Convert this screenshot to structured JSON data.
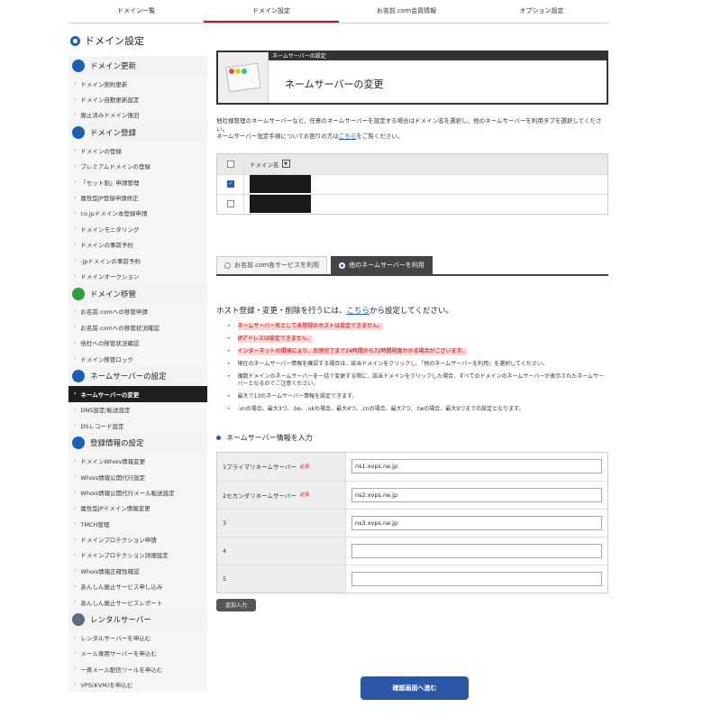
{
  "top_nav": [
    {
      "label": "ドメイン一覧",
      "active": false
    },
    {
      "label": "ドメイン設定",
      "active": true
    },
    {
      "label": "お名前.com会員情報",
      "active": false
    },
    {
      "label": "オプション設定",
      "active": false
    }
  ],
  "sidebar": {
    "title": "ドメイン設定",
    "groups": [
      {
        "label": "ドメイン更新",
        "icon": "refresh-icon",
        "items": [
          "ドメイン契約更新",
          "ドメイン自動更新設定",
          "廃止済みドメイン復旧"
        ]
      },
      {
        "label": "ドメイン登録",
        "icon": "plus-icon",
        "items": [
          "ドメインの登録",
          "プレミアムドメインの登録",
          "「セット割」申請管理",
          "属性型JP登録申請修正",
          "co.jpドメイン本登録申請",
          "ドメインモニタリング",
          "ドメインの事前予約",
          ".jpドメインの事前予約",
          "ドメインオークション"
        ]
      },
      {
        "label": "ドメイン移管",
        "icon": "transfer-icon",
        "items": [
          "お名前.comへの移管申請",
          "お名前.comへの移管状況確認",
          "他社への移管状況確認",
          "ドメイン移管ロック"
        ]
      },
      {
        "label": "ネームサーバーの設定",
        "icon": "server-icon",
        "items": [
          "ネームサーバーの変更",
          "DNS設定/転送設定",
          "DSレコード設定"
        ]
      },
      {
        "label": "登録情報の設定",
        "icon": "document-icon",
        "items": [
          "ドメインWhois情報変更",
          "Whois情報公開代行設定",
          "Whois情報公開代行メール転送設定",
          "属性型JPドメイン情報変更",
          "TMCH管理",
          "ドメインプロテクション申請",
          "ドメインプロテクション詳細設定",
          "Whois情報正確性確認",
          "あんしん廃止サービス申し込み",
          "あんしん廃止サービスレポート"
        ]
      },
      {
        "label": "レンタルサーバー",
        "icon": "building-icon",
        "items": [
          "レンタルサーバーを申込む",
          "メール専用サーバーを申込む",
          "一斉メール配信ツールを申込む",
          "VPS(KVM)を申込む"
        ]
      }
    ],
    "active_item": "ネームサーバーの変更"
  },
  "hero": {
    "tag": "ネームサーバーの設定",
    "title": "ネームサーバーの変更"
  },
  "desc": {
    "line1": "他社様管理のネームサーバーなど、任意のネームサーバーを設定する場合はドメイン名を選択し、他のネームサーバーを利用タブを選択してください。",
    "line2_pre": "ネームサーバー設定手順についてお困りの方は",
    "line2_link": "こちら",
    "line2_post": "をご覧ください。"
  },
  "domain_table": {
    "header": "ドメイン名",
    "rows": [
      {
        "checked": true
      },
      {
        "checked": false
      }
    ]
  },
  "server_tabs": [
    {
      "label": "お名前.com各サービスを利用",
      "active": false
    },
    {
      "label": "他のネームサーバーを利用",
      "active": true
    }
  ],
  "host": {
    "pre": "ホスト登録・変更・削除を行うには、",
    "link": "こちら",
    "post": "から設定してください。"
  },
  "notes": [
    {
      "text": "ネームサーバー名として未登録のホストは設定できません。",
      "warn": true
    },
    {
      "text": "IPアドレスは設定できません。",
      "warn": true
    },
    {
      "text": "インターネットの環境により、反映完了まで24時間から72時間程度かかる場合がございます。",
      "warn": true
    },
    {
      "text": "現在のネームサーバー情報を確認する場合は、該当ドメインをクリックし、「他のネームサーバーを利用」を選択してください。",
      "warn": false
    },
    {
      "text": "複数ドメインのネームサーバーを一括で変更する際に、該当ドメインをクリックした場合、すべてのドメインのネームサーバーが表示されたネームサーバーとなるのでご注意ください。",
      "warn": false
    },
    {
      "text": "最大で13のネームサーバー情報を設定できます。",
      "warn": false
    },
    {
      "text": ".vnの場合、最大3つ、.be、.ukの場合、最大4つ、.cnの場合、最大7つ、.twの場合、最大9つまでの設定となります。",
      "warn": false
    }
  ],
  "ns_section_title": "ネームサーバー情報を入力",
  "ns_rows": [
    {
      "label": "1プライマリネームサーバー",
      "required": "必須",
      "value": "ns1.xvps.ne.jp"
    },
    {
      "label": "2セカンダリネームサーバー",
      "required": "必須",
      "value": "ns2.xvps.ne.jp"
    },
    {
      "label": "3",
      "required": "",
      "value": "ns3.xvps.ne.jp"
    },
    {
      "label": "4",
      "required": "",
      "value": ""
    },
    {
      "label": "5",
      "required": "",
      "value": ""
    }
  ],
  "add_label": "追加入力",
  "confirm_label": "確認画面へ進む",
  "colors": {
    "accent": "#1a5fb4",
    "warn_bg": "#f7d6d6",
    "warn_text": "#cc0000",
    "button": "#2b57a6"
  }
}
